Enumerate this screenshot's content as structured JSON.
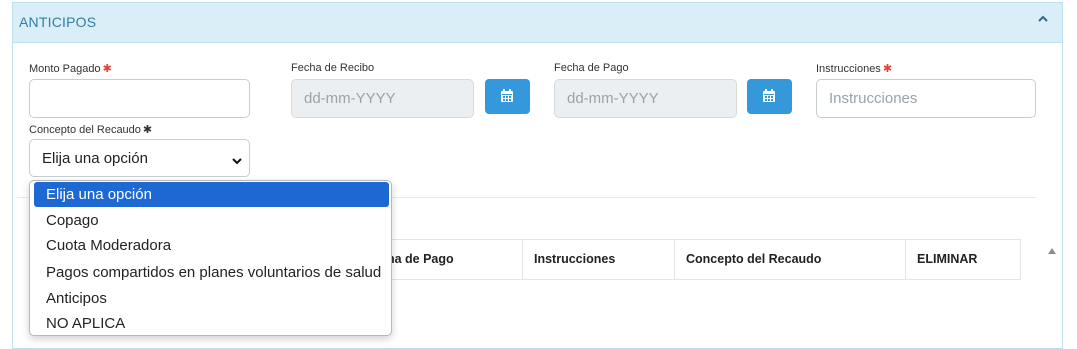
{
  "panel": {
    "title": "ANTICIPOS"
  },
  "form": {
    "monto_pagado": {
      "label": "Monto Pagado",
      "required_mark": "✱",
      "value": ""
    },
    "fecha_recibo": {
      "label": "Fecha de Recibo",
      "placeholder": "dd-mm-YYYY"
    },
    "fecha_pago": {
      "label": "Fecha de Pago",
      "placeholder": "dd-mm-YYYY"
    },
    "instrucciones": {
      "label": "Instrucciones",
      "required_mark": "✱",
      "placeholder": "Instrucciones"
    },
    "concepto": {
      "label": "Concepto del Recaudo",
      "required_mark": "✱",
      "selected": "Elija una opción"
    }
  },
  "dropdown": {
    "options": [
      "Elija una opción",
      "Copago",
      "Cuota Moderadora",
      "Pagos compartidos en planes voluntarios de salud",
      "Anticipos",
      "NO APLICA"
    ]
  },
  "table": {
    "headers": [
      "cha de Pago",
      "Instrucciones",
      "Concepto del Recaudo",
      "ELIMINAR"
    ]
  },
  "colors": {
    "header_bg": "#d9eef7",
    "title": "#2f7fa5",
    "accent_button": "#3498db",
    "required": "#e8403a",
    "selected_option": "#1e68d4"
  },
  "icons": {
    "collapse": "chevron-up-icon",
    "calendar": "calendar-icon",
    "select_caret": "chevron-down-icon",
    "scroll": "triangle-up-icon"
  }
}
